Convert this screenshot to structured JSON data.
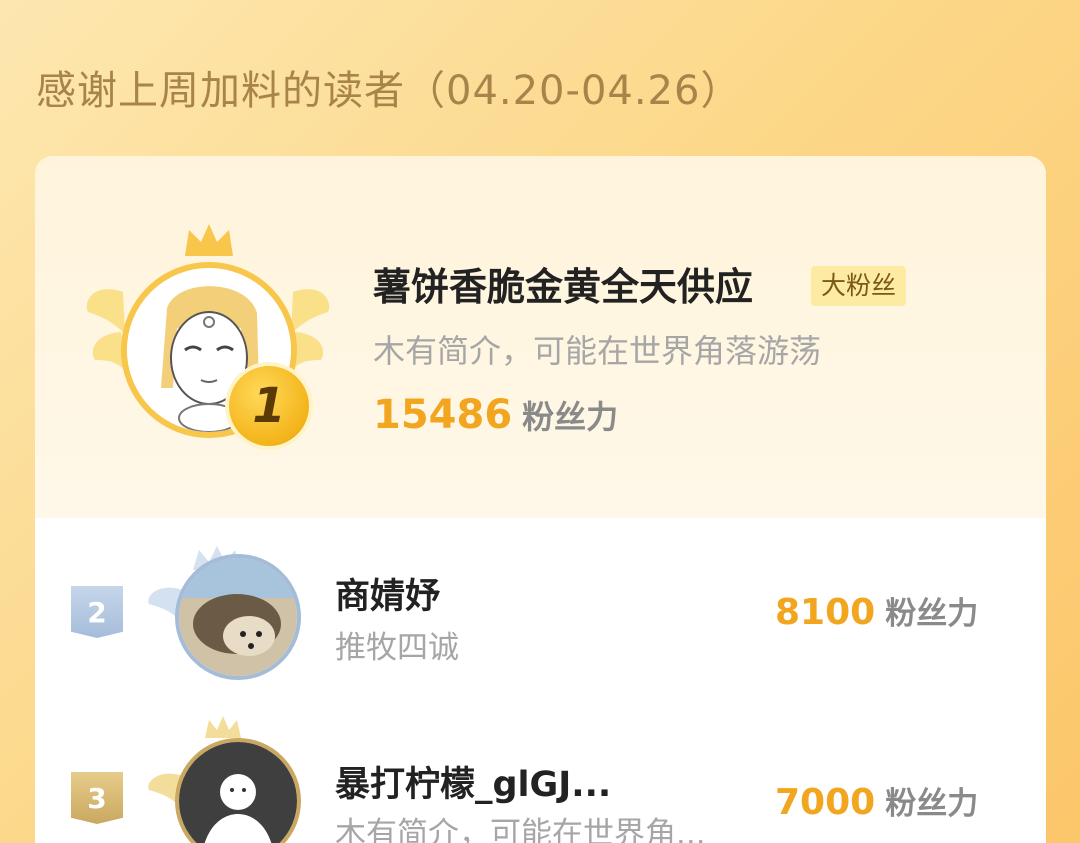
{
  "header": {
    "title": "感谢上周加料的读者（04.20-04.26）"
  },
  "top_fan": {
    "rank": "1",
    "name": "薯饼香脆金黄全天供应",
    "tag": "大粉丝",
    "bio": "木有简介，可能在世界角落游荡",
    "score": "15486",
    "score_unit": "粉丝力"
  },
  "fans": [
    {
      "rank": "2",
      "name": "商婧妤",
      "bio": "推牧四诚",
      "score": "8100",
      "score_unit": "粉丝力"
    },
    {
      "rank": "3",
      "name": "暴打柠檬_glGJ...",
      "bio": "木有简介，可能在世界角...",
      "score": "7000",
      "score_unit": "粉丝力"
    }
  ],
  "colors": {
    "accent": "#f2a51e",
    "gold": "#f7c64a",
    "silver": "#a5bcd9",
    "bronze": "#caa860"
  }
}
